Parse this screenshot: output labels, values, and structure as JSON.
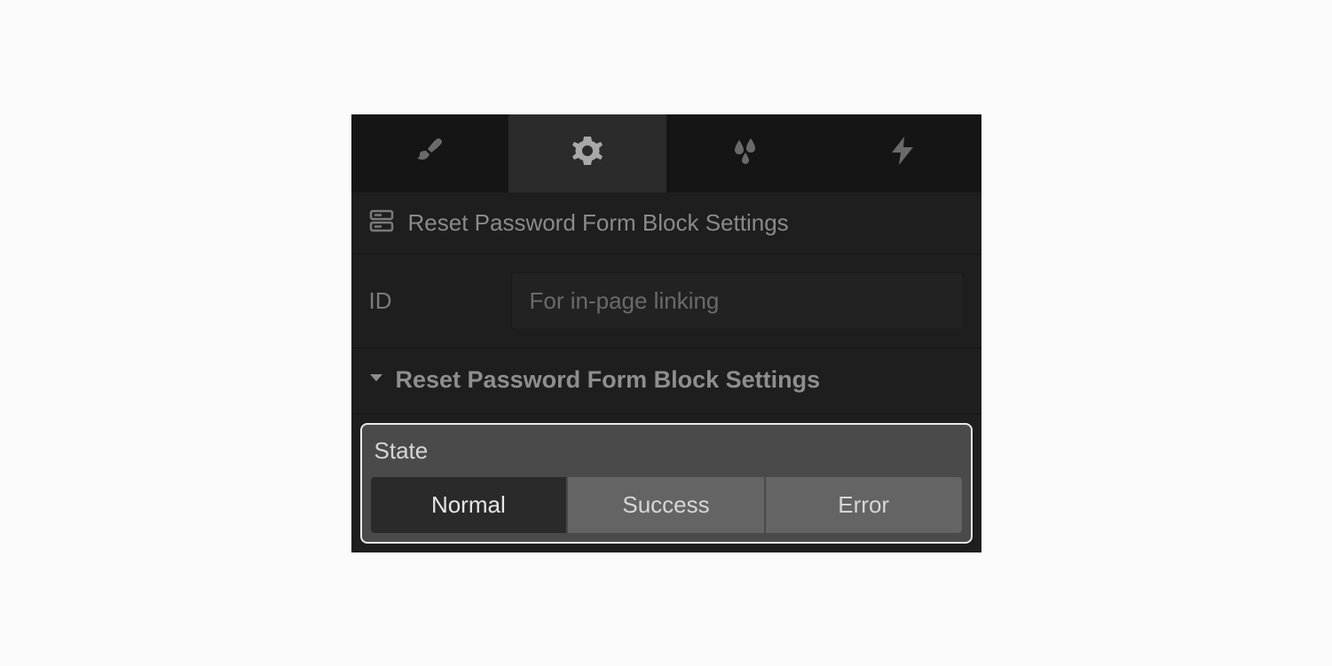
{
  "tabs": {
    "style": "style",
    "settings": "settings",
    "effects": "effects",
    "interactions": "interactions",
    "active_index": 1
  },
  "breadcrumb": {
    "title": "Reset Password Form Block Settings"
  },
  "id_field": {
    "label": "ID",
    "placeholder": "For in-page linking",
    "value": ""
  },
  "section": {
    "title": "Reset Password Form Block Settings",
    "expanded": true
  },
  "state": {
    "label": "State",
    "options": [
      "Normal",
      "Success",
      "Error"
    ],
    "selected_index": 0
  }
}
